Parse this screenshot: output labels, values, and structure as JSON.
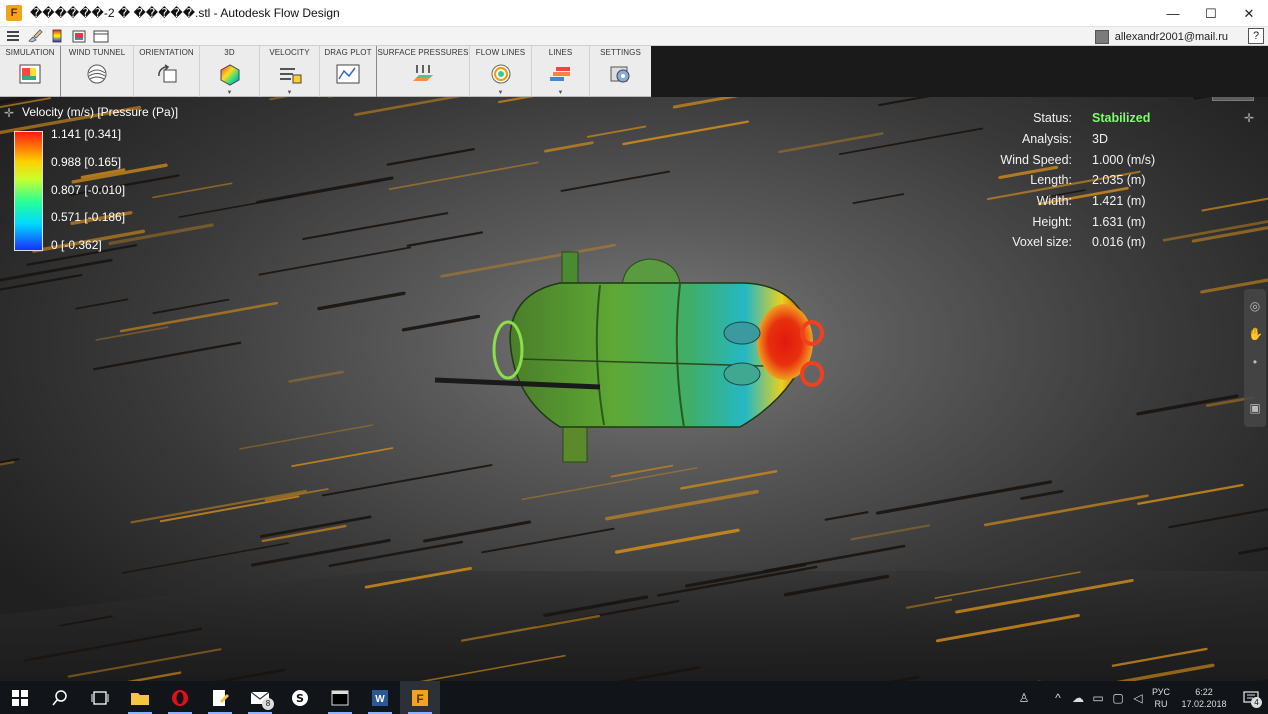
{
  "window": {
    "title": "������-2 � �����.stl - Autodesk Flow Design",
    "app_icon_letter": "F",
    "minimize": "—",
    "maximize": "☐",
    "close": "✕"
  },
  "quickbar": {
    "user": "allexandr2001@mail.ru",
    "help": "?"
  },
  "ribbon": {
    "groups": [
      {
        "label": "SIMULATION",
        "icon": "simulation-icon"
      },
      {
        "label": "WIND TUNNEL",
        "icon": "wind-tunnel-icon"
      },
      {
        "label": "ORIENTATION",
        "icon": "orientation-icon"
      },
      {
        "label": "3D",
        "icon": "3d-icon",
        "dropdown": "▼"
      },
      {
        "label": "VELOCITY",
        "icon": "velocity-icon",
        "dropdown": "▼"
      },
      {
        "label": "DRAG PLOT",
        "icon": "drag-plot-icon"
      },
      {
        "label": "SURFACE PRESSURES",
        "icon": "surface-pressures-icon"
      },
      {
        "label": "FLOW LINES",
        "icon": "flow-lines-icon",
        "dropdown": "▼"
      },
      {
        "label": "LINES",
        "icon": "lines-icon",
        "dropdown": "▼"
      },
      {
        "label": "SETTINGS",
        "icon": "settings-icon"
      }
    ]
  },
  "legend": {
    "title": "Velocity (m/s) [Pressure (Pa)]",
    "items": [
      "1.141 [0.341]",
      "0.988 [0.165]",
      "0.807 [-0.010]",
      "0.571 [-0.186]",
      "0 [-0.362]"
    ],
    "colors": [
      "#ff1a10",
      "#ffd000",
      "#c9ff30",
      "#22ff9a",
      "#00d8ff",
      "#1830ff"
    ]
  },
  "status": {
    "rows": [
      {
        "key": "Status:",
        "value": "Stabilized"
      },
      {
        "key": "Analysis:",
        "value": "3D"
      },
      {
        "key": "Wind Speed:",
        "value": "1.000 (m/s)"
      },
      {
        "key": "Length:",
        "value": "2.035 (m)"
      },
      {
        "key": "Width:",
        "value": "1.421 (m)"
      },
      {
        "key": "Height:",
        "value": "1.631 (m)"
      },
      {
        "key": "Voxel size:",
        "value": "0.016 (m)"
      }
    ]
  },
  "taskbar": {
    "lang_top": "РУС",
    "lang_bottom": "RU",
    "time": "6:22",
    "date": "17.02.2018",
    "mail_badge": "8",
    "notif_badge": "4"
  },
  "colors": {
    "accent_green": "#7bff6a",
    "streak_orange": "#d08a1a"
  }
}
